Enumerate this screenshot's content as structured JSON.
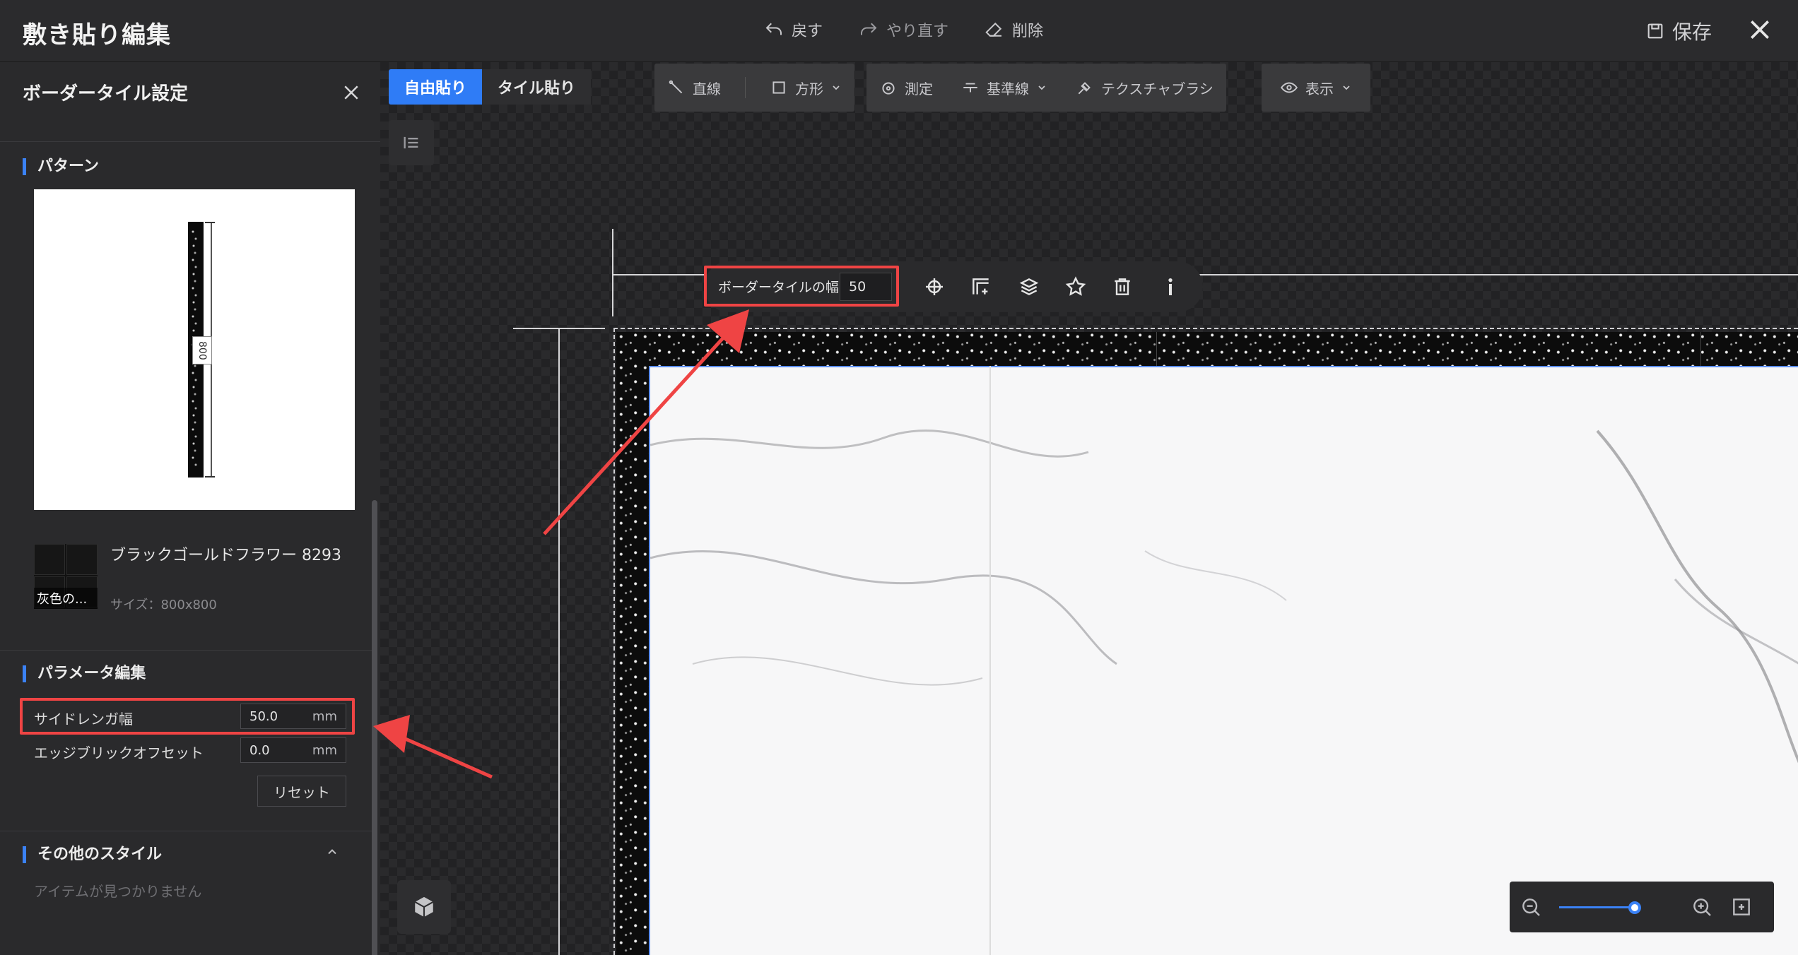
{
  "app": {
    "title": "敷き貼り編集",
    "actions": {
      "undo": "戻す",
      "redo": "やり直す",
      "delete": "削除"
    },
    "save": "保存"
  },
  "panel": {
    "title": "ボーダータイル設定",
    "pattern_section": "パターン",
    "strip_label": "800",
    "tile": {
      "name": "ブラックゴールドフラワー 8293",
      "size": "サイズ：800x800",
      "thumb_caption": "灰色の..."
    },
    "param_section": "パラメータ編集",
    "params": [
      {
        "label": "サイドレンガ幅",
        "value": "50.0",
        "unit": "mm"
      },
      {
        "label": "エッジブリックオフセット",
        "value": "0.0",
        "unit": "mm"
      }
    ],
    "reset": "リセット",
    "other_section": "その他のスタイル",
    "empty": "アイテムが見つかりません"
  },
  "canvas": {
    "modes": [
      "自由貼り",
      "タイル貼り"
    ],
    "tools": {
      "line": "直線",
      "rect": "方形",
      "measure": "測定",
      "baseline": "基準線",
      "texture_brush": "テクスチャブラシ",
      "view": "表示"
    },
    "float_bar": {
      "label": "ボーダータイルの幅",
      "value": "50"
    }
  },
  "colors": {
    "accent": "#2f7cf6",
    "highlight": "#ef4444",
    "bg": "#1f1f21"
  }
}
